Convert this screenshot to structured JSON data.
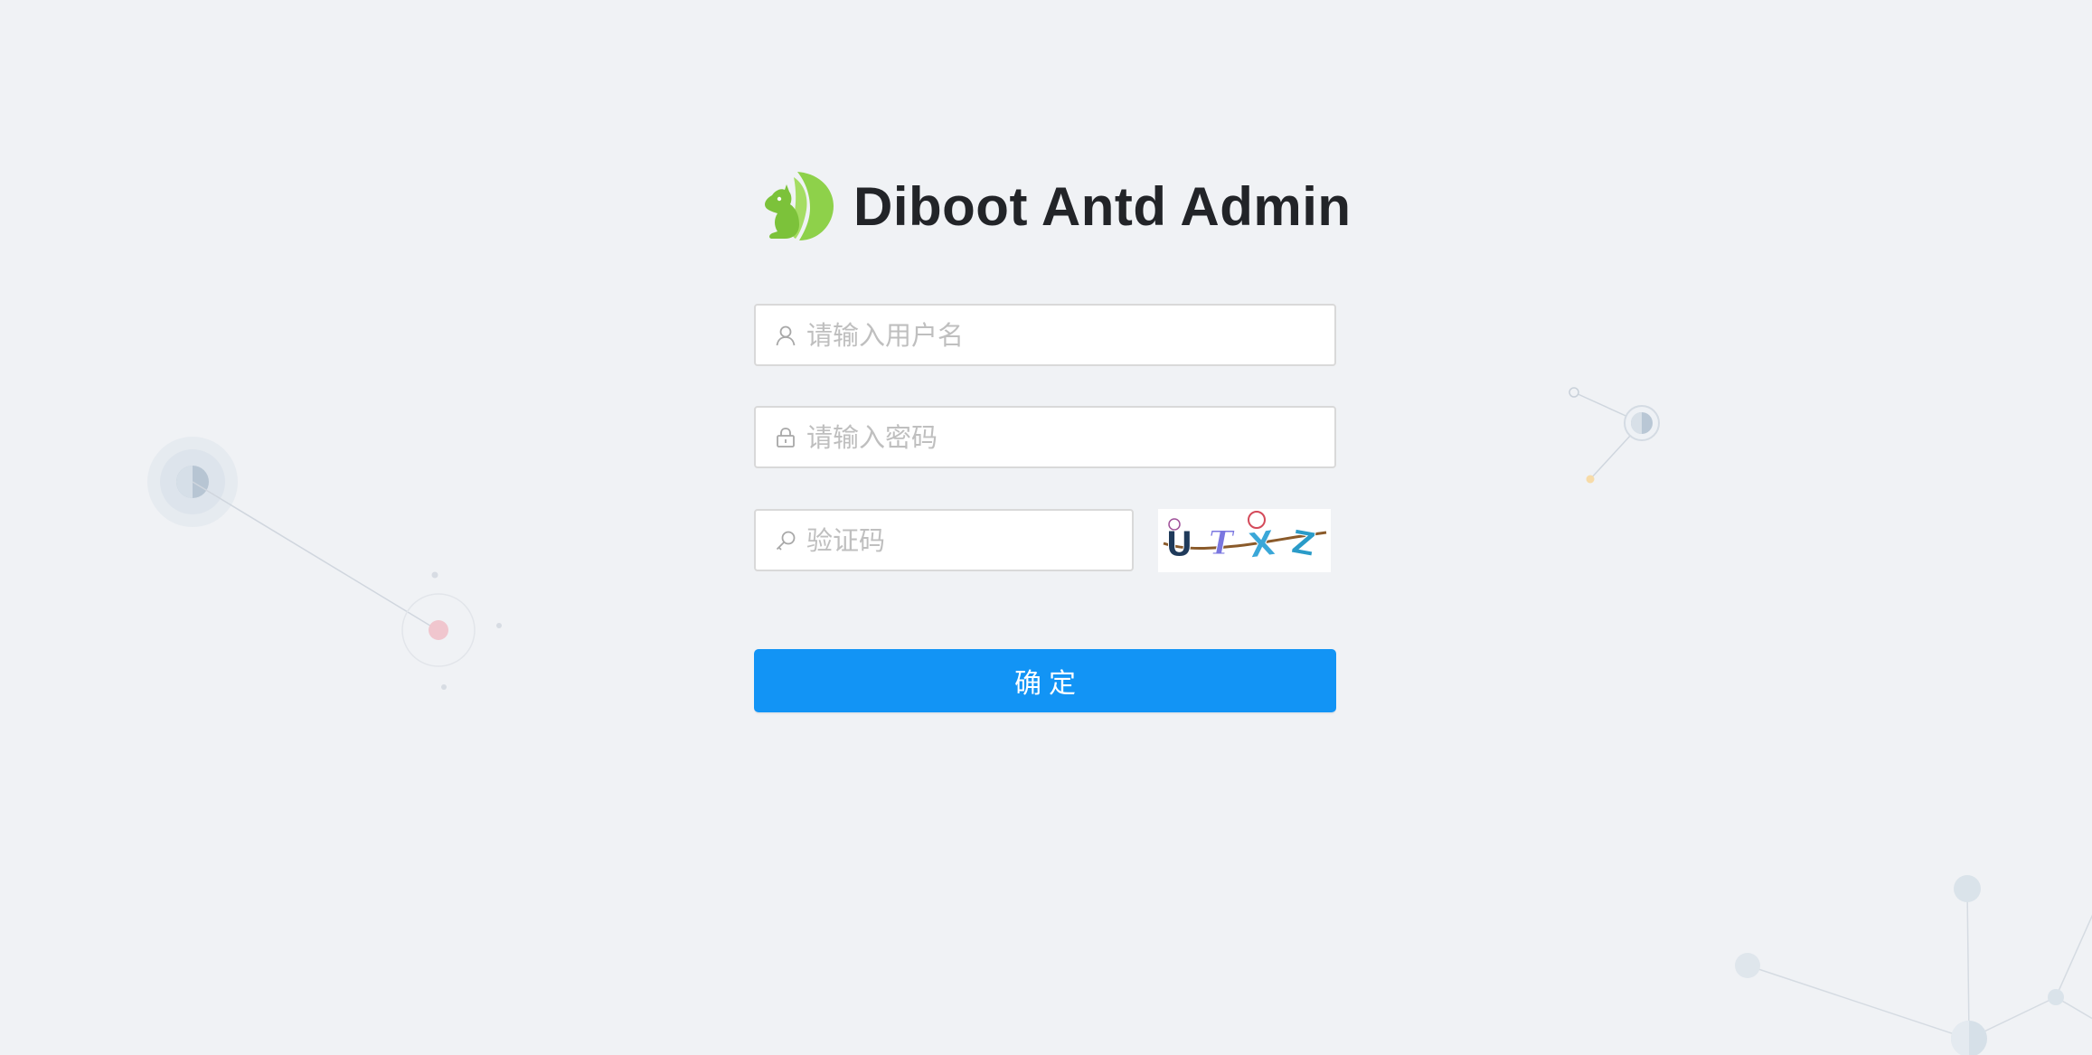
{
  "app": {
    "title": "Diboot Antd Admin",
    "logo_icon": "squirrel-logo-icon"
  },
  "login_form": {
    "username": {
      "placeholder": "请输入用户名",
      "value": "",
      "icon": "user-icon"
    },
    "password": {
      "placeholder": "请输入密码",
      "value": "",
      "icon": "lock-icon"
    },
    "captcha": {
      "placeholder": "验证码",
      "value": "",
      "icon": "key-icon",
      "image_text": "UTXZ"
    },
    "submit_label": "确定"
  },
  "colors": {
    "background": "#f0f2f5",
    "primary": "#1294f5",
    "title": "#222428",
    "logo": "#8ed14a"
  }
}
